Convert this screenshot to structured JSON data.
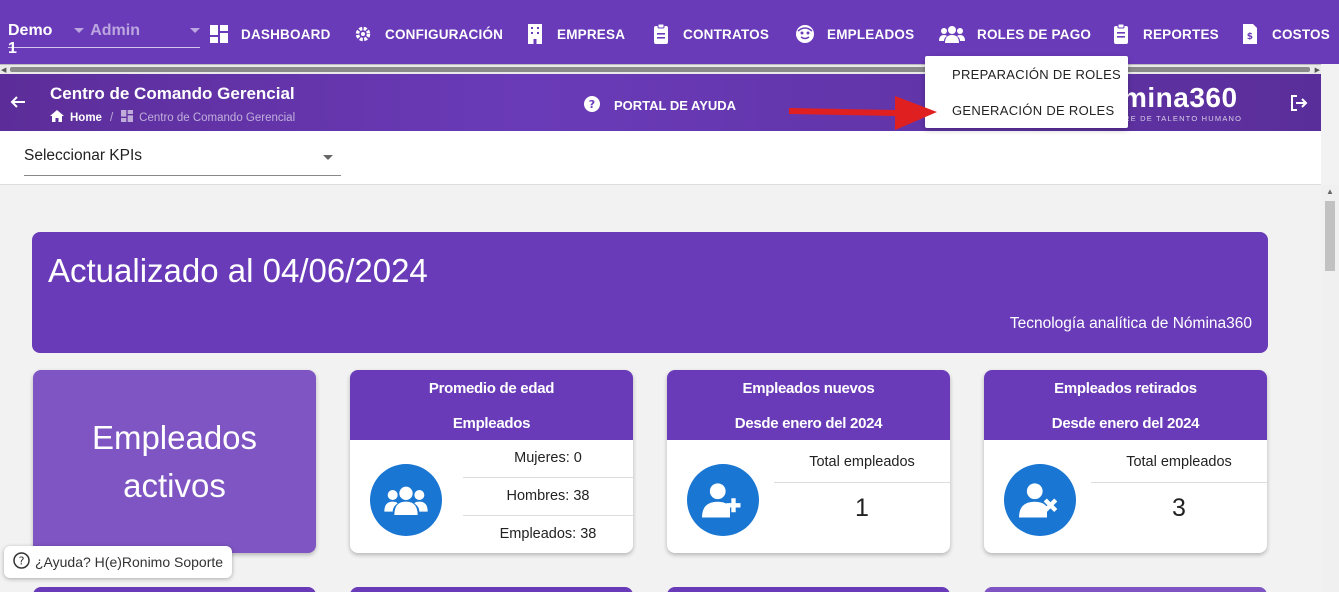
{
  "topnav": {
    "company": "Demo 1",
    "role": "Admin",
    "items": [
      {
        "label": "DASHBOARD",
        "icon": "dashboard-icon"
      },
      {
        "label": "CONFIGURACIÓN",
        "icon": "gear-icon"
      },
      {
        "label": "EMPRESA",
        "icon": "building-icon"
      },
      {
        "label": "CONTRATOS",
        "icon": "clipboard-icon"
      },
      {
        "label": "EMPLEADOS",
        "icon": "face-icon"
      },
      {
        "label": "ROLES DE PAGO",
        "icon": "users-icon"
      },
      {
        "label": "REPORTES",
        "icon": "clipboard-list-icon"
      },
      {
        "label": "COSTOS",
        "icon": "invoice-icon"
      }
    ]
  },
  "dropdown": {
    "items": [
      "PREPARACIÓN DE ROLES",
      "GENERACIÓN DE ROLES"
    ]
  },
  "header": {
    "title": "Centro de Comando Gerencial",
    "breadcrumb_home": "Home",
    "breadcrumb_current": "Centro de Comando Gerencial",
    "help_label": "PORTAL DE AYUDA",
    "brand": "mina360",
    "brand_sub": "RE DE TALENTO HUMANO"
  },
  "kpi": {
    "label": "Seleccionar KPIs"
  },
  "banner": {
    "title": "Actualizado al 04/06/2024",
    "subtitle": "Tecnología analítica de Nómina360"
  },
  "cards": {
    "active": {
      "line1": "Empleados",
      "line2": "activos"
    },
    "age": {
      "title1": "Promedio de edad",
      "title2": "Empleados",
      "women": "Mujeres: 0",
      "men": "Hombres: 38",
      "total": "Empleados: 38"
    },
    "new": {
      "title1": "Empleados nuevos",
      "title2": "Desde enero del 2024",
      "total_label": "Total empleados",
      "total_value": "1"
    },
    "retired": {
      "title1": "Empleados retirados",
      "title2": "Desde enero del 2024",
      "total_label": "Total empleados",
      "total_value": "3"
    }
  },
  "help_chip": {
    "label": "¿Ayuda? H(e)Ronimo Soporte"
  },
  "colors": {
    "primary": "#6a3bb8",
    "accent_blue": "#1976d2",
    "arrow_red": "#e02020"
  }
}
